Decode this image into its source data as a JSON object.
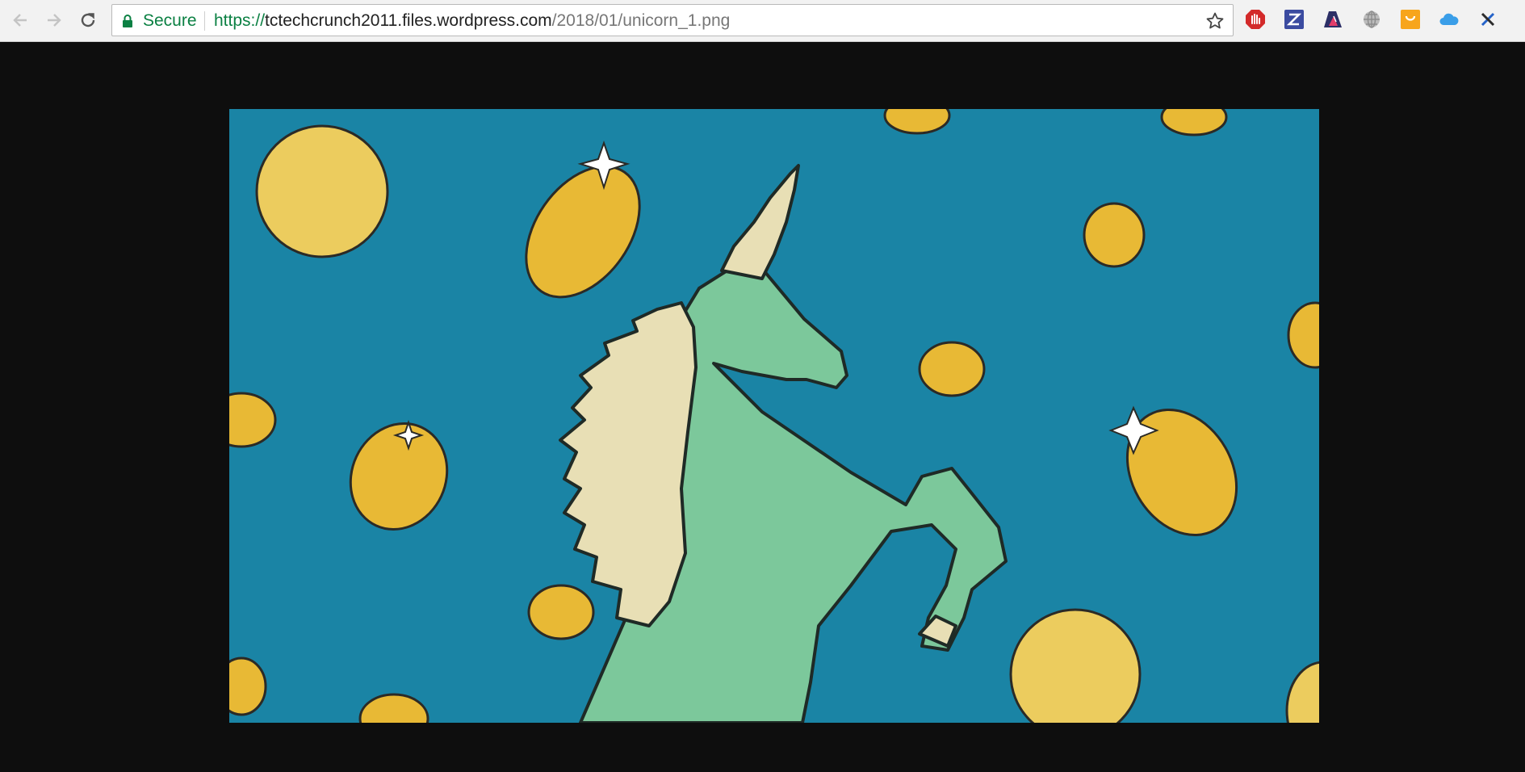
{
  "toolbar": {
    "secure_label": "Secure",
    "url_scheme": "https://",
    "url_host": "tctechcrunch2011.files.wordpress.com",
    "url_path": "/2018/01/unicorn_1.png",
    "nav_icons": [
      "back-arrow-icon",
      "forward-arrow-icon",
      "reload-icon"
    ],
    "bookmark_icon": "star-icon",
    "extensions": [
      "adblock-hand-icon",
      "z-extension-icon",
      "reader-extension-icon",
      "globe-icon",
      "honey-extension-icon",
      "cloud-icon",
      "cross-extension-icon"
    ]
  },
  "colors": {
    "toolbar_bg": "#f2f2f2",
    "secure_green": "#0b8043",
    "page_bg": "#0e0e0e",
    "image_bg": "#1a84a5",
    "coin": "#e8b935",
    "unicorn": "#7cc89b",
    "mane": "#e8dfb5"
  },
  "image": {
    "subject": "unicorn-illustration"
  }
}
